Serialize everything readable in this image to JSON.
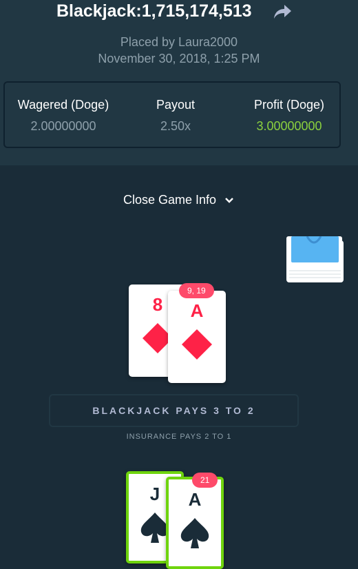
{
  "header": {
    "title": "Blackjack:1,715,174,513",
    "placed_by": "Placed by Laura2000",
    "date": "November 30, 2018, 1:25 PM"
  },
  "stats": {
    "wagered_label": "Wagered (Doge)",
    "wagered_value": "2.00000000",
    "payout_label": "Payout",
    "payout_value": "2.50x",
    "profit_label": "Profit (Doge)",
    "profit_value": "3.00000000"
  },
  "game_info": {
    "toggle_label": "Close Game Info"
  },
  "dealer_hand": {
    "total": "9, 19",
    "cards": [
      {
        "rank": "8",
        "suit": "diamond-icon"
      },
      {
        "rank": "A",
        "suit": "diamond-icon"
      }
    ]
  },
  "table_text": {
    "blackjack_pays": "BLACKJACK PAYS 3 TO 2",
    "insurance_pays": "INSURANCE PAYS 2 TO 1"
  },
  "player_hand": {
    "total": "21",
    "cards": [
      {
        "rank": "J",
        "suit": "spade-icon"
      },
      {
        "rank": "A",
        "suit": "spade-icon"
      }
    ]
  },
  "colors": {
    "header_bg": "#213743",
    "table_bg": "#1a2c38",
    "profit": "#8bd13e",
    "red_suit": "#fe2247",
    "badge": "#fe4a6a",
    "win_border": "#6fd40e",
    "deck_blue": "#57b4f2"
  }
}
